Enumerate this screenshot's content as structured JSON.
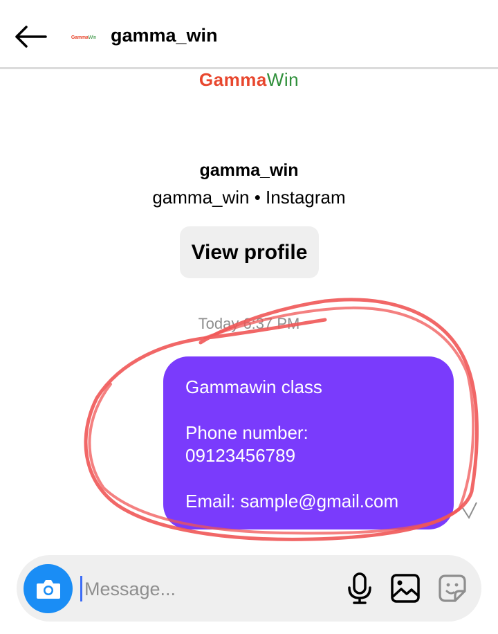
{
  "header": {
    "title": "gamma_win",
    "avatar_text_a": "Gamma",
    "avatar_text_b": "Win"
  },
  "profile": {
    "logo_gamma": "Gamma",
    "logo_win": "Win",
    "name": "gamma_win",
    "subtitle": "gamma_win • Instagram",
    "view_profile_label": "View profile"
  },
  "thread": {
    "timestamp": "Today 6:37 PM",
    "message": {
      "line1": "Gammawin class",
      "line2": "Phone number:",
      "line3": "09123456789",
      "line4": "Email: sample@gmail.com"
    }
  },
  "composer": {
    "placeholder": "Message..."
  },
  "icons": {
    "back": "arrow-left-icon",
    "camera": "camera-icon",
    "mic": "microphone-icon",
    "gallery": "gallery-icon",
    "sticker": "sticker-icon",
    "seen": "check-icon"
  },
  "colors": {
    "bubble": "#7a3bfc",
    "camera": "#1a8df5",
    "annotation": "#f05656",
    "logo_gamma": "#e8472e",
    "logo_win": "#2f8f3a"
  }
}
